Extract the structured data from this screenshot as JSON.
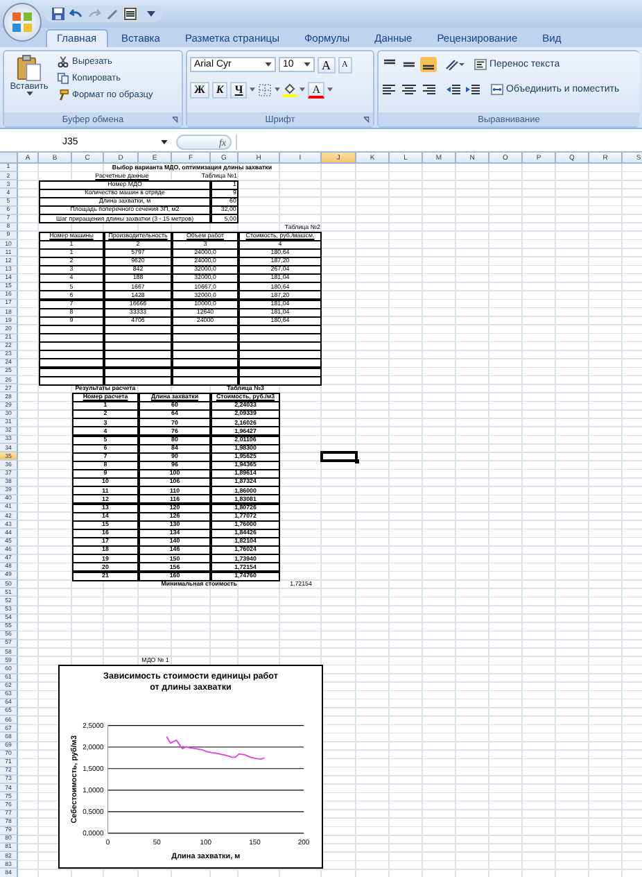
{
  "tabs": [
    {
      "label": "Главная",
      "selected": true
    },
    {
      "label": "Вставка",
      "selected": false
    },
    {
      "label": "Разметка страницы",
      "selected": false
    },
    {
      "label": "Формулы",
      "selected": false
    },
    {
      "label": "Данные",
      "selected": false
    },
    {
      "label": "Рецензирование",
      "selected": false
    },
    {
      "label": "Вид",
      "selected": false
    }
  ],
  "ribbon": {
    "clipboard": {
      "paste": "Вставить",
      "cut": "Вырезать",
      "copy": "Копировать",
      "format_painter": "Формат по образцу",
      "label": "Буфер обмена"
    },
    "font": {
      "name": "Arial Cyr",
      "size": "10",
      "grow": "A",
      "shrink": "A",
      "bold": "Ж",
      "italic": "К",
      "underline": "Ч",
      "font_color": "A",
      "label": "Шрифт"
    },
    "alignment": {
      "vertical": [
        {
          "selected": false
        },
        {
          "selected": false
        },
        {
          "selected": true
        }
      ],
      "wrap_text": "Перенос текста",
      "merge": "Объединить и поместить",
      "label": "Выравнивание"
    }
  },
  "formula_bar": {
    "name_box": "J35",
    "function_button": "fx"
  },
  "sheet": {
    "columns": [
      {
        "label": "A",
        "selected": false
      },
      {
        "label": "B",
        "selected": false
      },
      {
        "label": "C",
        "selected": false
      },
      {
        "label": "D",
        "selected": false
      },
      {
        "label": "E",
        "selected": false
      },
      {
        "label": "F",
        "selected": false
      },
      {
        "label": "G",
        "selected": false
      },
      {
        "label": "H",
        "selected": false
      },
      {
        "label": "I",
        "selected": false
      },
      {
        "label": "J",
        "selected": true
      },
      {
        "label": "K",
        "selected": false
      },
      {
        "label": "L",
        "selected": false
      },
      {
        "label": "M",
        "selected": false
      },
      {
        "label": "N",
        "selected": false
      },
      {
        "label": "O",
        "selected": false
      },
      {
        "label": "P",
        "selected": false
      },
      {
        "label": "Q",
        "selected": false
      },
      {
        "label": "R",
        "selected": false
      },
      {
        "label": "S",
        "selected": false
      }
    ],
    "rows": [
      {
        "label": "1",
        "selected": false
      },
      {
        "label": "2",
        "selected": false
      },
      {
        "label": "3",
        "selected": false
      },
      {
        "label": "4",
        "selected": false
      },
      {
        "label": "5",
        "selected": false
      },
      {
        "label": "6",
        "selected": false
      },
      {
        "label": "7",
        "selected": false
      },
      {
        "label": "8",
        "selected": false
      },
      {
        "label": "9",
        "selected": false
      },
      {
        "label": "10",
        "selected": false
      },
      {
        "label": "11",
        "selected": false
      },
      {
        "label": "12",
        "selected": false
      },
      {
        "label": "13",
        "selected": false
      },
      {
        "label": "14",
        "selected": false
      },
      {
        "label": "15",
        "selected": false
      },
      {
        "label": "16",
        "selected": false
      },
      {
        "label": "17",
        "selected": false
      },
      {
        "label": "18",
        "selected": false
      },
      {
        "label": "19",
        "selected": false
      },
      {
        "label": "20",
        "selected": false
      },
      {
        "label": "21",
        "selected": false
      },
      {
        "label": "22",
        "selected": false
      },
      {
        "label": "23",
        "selected": false
      },
      {
        "label": "24",
        "selected": false
      },
      {
        "label": "25",
        "selected": false
      },
      {
        "label": "26",
        "selected": false
      },
      {
        "label": "27",
        "selected": false
      },
      {
        "label": "28",
        "selected": false
      },
      {
        "label": "29",
        "selected": false
      },
      {
        "label": "30",
        "selected": false
      },
      {
        "label": "31",
        "selected": false
      },
      {
        "label": "32",
        "selected": false
      },
      {
        "label": "33",
        "selected": false
      },
      {
        "label": "34",
        "selected": false
      },
      {
        "label": "35",
        "selected": true
      },
      {
        "label": "36",
        "selected": false
      },
      {
        "label": "37",
        "selected": false
      },
      {
        "label": "38",
        "selected": false
      },
      {
        "label": "39",
        "selected": false
      },
      {
        "label": "40",
        "selected": false
      },
      {
        "label": "41",
        "selected": false
      },
      {
        "label": "42",
        "selected": false
      },
      {
        "label": "43",
        "selected": false
      },
      {
        "label": "44",
        "selected": false
      },
      {
        "label": "45",
        "selected": false
      },
      {
        "label": "46",
        "selected": false
      },
      {
        "label": "47",
        "selected": false
      },
      {
        "label": "48",
        "selected": false
      },
      {
        "label": "49",
        "selected": false
      },
      {
        "label": "50",
        "selected": false
      },
      {
        "label": "51",
        "selected": false
      },
      {
        "label": "52",
        "selected": false
      },
      {
        "label": "53",
        "selected": false
      },
      {
        "label": "54",
        "selected": false
      },
      {
        "label": "55",
        "selected": false
      },
      {
        "label": "56",
        "selected": false
      },
      {
        "label": "57",
        "selected": false
      },
      {
        "label": "58",
        "selected": false
      },
      {
        "label": "59",
        "selected": false
      },
      {
        "label": "60",
        "selected": false
      },
      {
        "label": "61",
        "selected": false
      },
      {
        "label": "62",
        "selected": false
      },
      {
        "label": "63",
        "selected": false
      },
      {
        "label": "64",
        "selected": false
      },
      {
        "label": "65",
        "selected": false
      },
      {
        "label": "66",
        "selected": false
      },
      {
        "label": "67",
        "selected": false
      },
      {
        "label": "68",
        "selected": false
      },
      {
        "label": "69",
        "selected": false
      },
      {
        "label": "70",
        "selected": false
      },
      {
        "label": "71",
        "selected": false
      },
      {
        "label": "72",
        "selected": false
      },
      {
        "label": "73",
        "selected": false
      },
      {
        "label": "74",
        "selected": false
      },
      {
        "label": "75",
        "selected": false
      },
      {
        "label": "76",
        "selected": false
      },
      {
        "label": "77",
        "selected": false
      },
      {
        "label": "78",
        "selected": false
      },
      {
        "label": "79",
        "selected": false
      },
      {
        "label": "80",
        "selected": false
      },
      {
        "label": "81",
        "selected": false
      },
      {
        "label": "82",
        "selected": false
      },
      {
        "label": "83",
        "selected": false
      },
      {
        "label": "84",
        "selected": false
      }
    ]
  },
  "table_1": {
    "title": "Выбор варианта МДО, оптимизация длины захватки",
    "caption": "Расчетные данные",
    "label": "Таблица №1",
    "rows": [
      {
        "name": "Номер МДО",
        "value": "1"
      },
      {
        "name": "Количество машин в отряде",
        "value": "9"
      },
      {
        "name": "Длина захватки, м",
        "value": "60"
      },
      {
        "name": "Площадь поперечного сечения ЗП, м2",
        "value": "32,00"
      },
      {
        "name": "Шаг приращения длины захватки (3 - 15 метров)",
        "value": "5,00"
      }
    ]
  },
  "table_2": {
    "label": "Таблица №2",
    "columns": [
      "Номер машины",
      "Производительность",
      "Объем работ",
      "Стоимость, руб./машсм."
    ],
    "column_numbers": [
      "1",
      "2",
      "3",
      "4"
    ],
    "rows": [
      [
        "1",
        "5797",
        "24000,0",
        "180,64"
      ],
      [
        "2",
        "9620",
        "24000,0",
        "187,20"
      ],
      [
        "3",
        "842",
        "32000,0",
        "267,04"
      ],
      [
        "4",
        "188",
        "32000,0",
        "181,04"
      ],
      [
        "5",
        "1667",
        "10667,0",
        "180,64"
      ],
      [
        "6",
        "1428",
        "32000,0",
        "187,20"
      ],
      [
        "7",
        "16666",
        "10000,0",
        "181,04"
      ],
      [
        "8",
        "33333",
        "12640",
        "181,04"
      ],
      [
        "9",
        "4706",
        "24000",
        "180,64"
      ]
    ]
  },
  "table_3": {
    "caption": "Результаты расчета",
    "label": "Таблица №3",
    "columns": [
      "Номер расчета",
      "Длина захватки",
      "Стоимость, руб./м3"
    ],
    "rows": [
      [
        "1",
        "60",
        "2,24033"
      ],
      [
        "2",
        "64",
        "2,09339"
      ],
      [
        "3",
        "70",
        "2,16026"
      ],
      [
        "4",
        "76",
        "1,96427"
      ],
      [
        "5",
        "80",
        "2,01106"
      ],
      [
        "6",
        "84",
        "1,98300"
      ],
      [
        "7",
        "90",
        "1,95625"
      ],
      [
        "8",
        "96",
        "1,94365"
      ],
      [
        "9",
        "100",
        "1,89614"
      ],
      [
        "10",
        "106",
        "1,87324"
      ],
      [
        "11",
        "110",
        "1,86000"
      ],
      [
        "12",
        "116",
        "1,83081"
      ],
      [
        "13",
        "120",
        "1,80726"
      ],
      [
        "14",
        "126",
        "1,77072"
      ],
      [
        "15",
        "130",
        "1,76000"
      ],
      [
        "16",
        "134",
        "1,84426"
      ],
      [
        "17",
        "140",
        "1,82104"
      ],
      [
        "18",
        "146",
        "1,76024"
      ],
      [
        "19",
        "150",
        "1,73940"
      ],
      [
        "20",
        "156",
        "1,72154"
      ],
      [
        "21",
        "160",
        "1,74760"
      ]
    ],
    "min_label": "Минимальная стоимость",
    "min_value": "1,72154"
  },
  "chart_label": "МДО № 1",
  "chart": {
    "chart_data": {
      "type": "line",
      "title": "Зависимость стоимости единицы работ от длины захватки",
      "xlabel": "Длина захватки, м",
      "ylabel": "Себестоимость, руб/м3",
      "x": [
        60,
        64,
        70,
        76,
        80,
        84,
        90,
        96,
        100,
        106,
        110,
        116,
        120,
        126,
        130,
        134,
        140,
        146,
        150,
        156,
        160
      ],
      "series": [
        {
          "color": "#e040e0",
          "values": [
            2.24,
            2.09,
            2.16,
            1.96,
            2.01,
            1.98,
            1.96,
            1.94,
            1.9,
            1.87,
            1.86,
            1.83,
            1.81,
            1.77,
            1.76,
            1.84,
            1.82,
            1.76,
            1.74,
            1.72,
            1.75
          ]
        }
      ],
      "grid": true,
      "xlim": [
        0,
        200
      ],
      "ylim": [
        0,
        2.5
      ],
      "xticks": [
        0,
        50,
        100,
        150,
        200
      ],
      "yticks": [
        {
          "value": 0,
          "label": "0,0000"
        },
        {
          "value": 0.5,
          "label": "0,5000"
        },
        {
          "value": 1,
          "label": "1,0000"
        },
        {
          "value": 1.5,
          "label": "1,5000"
        },
        {
          "value": 2,
          "label": "2,0000"
        },
        {
          "value": 2.5,
          "label": "2,5000"
        }
      ]
    }
  }
}
